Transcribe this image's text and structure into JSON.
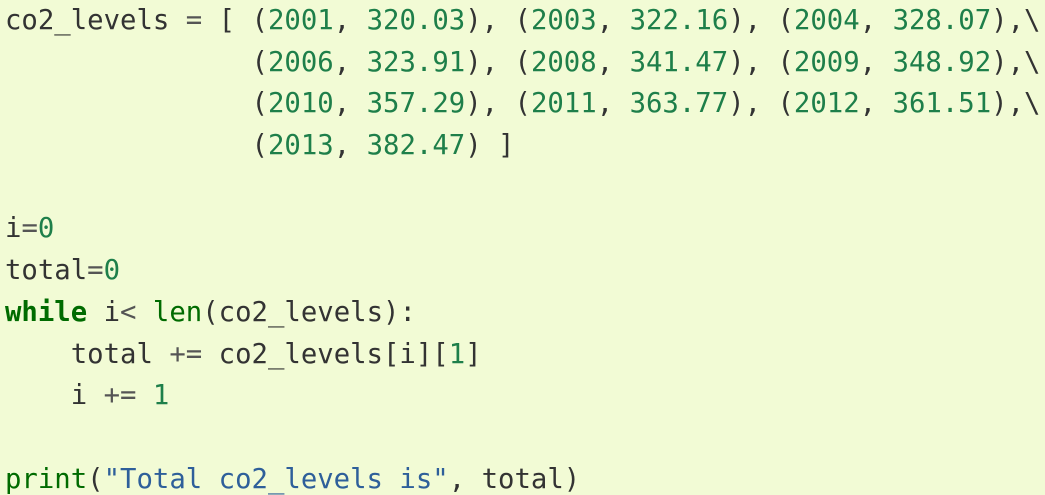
{
  "colors": {
    "background": "#f2fbd5",
    "text": "#333333",
    "number": "#1e7f4a",
    "keyword": "#006b00",
    "string": "#2e5f9a"
  },
  "code": {
    "lines": [
      [
        {
          "t": "co2_levels",
          "c": "txt"
        },
        {
          "t": " ",
          "c": "txt"
        },
        {
          "t": "=",
          "c": "op"
        },
        {
          "t": " [ (",
          "c": "txt"
        },
        {
          "t": "2001",
          "c": "num"
        },
        {
          "t": ", ",
          "c": "txt"
        },
        {
          "t": "320.03",
          "c": "num"
        },
        {
          "t": "), (",
          "c": "txt"
        },
        {
          "t": "2003",
          "c": "num"
        },
        {
          "t": ", ",
          "c": "txt"
        },
        {
          "t": "322.16",
          "c": "num"
        },
        {
          "t": "), (",
          "c": "txt"
        },
        {
          "t": "2004",
          "c": "num"
        },
        {
          "t": ", ",
          "c": "txt"
        },
        {
          "t": "328.07",
          "c": "num"
        },
        {
          "t": "),\\",
          "c": "txt"
        }
      ],
      [
        {
          "t": "               (",
          "c": "txt"
        },
        {
          "t": "2006",
          "c": "num"
        },
        {
          "t": ", ",
          "c": "txt"
        },
        {
          "t": "323.91",
          "c": "num"
        },
        {
          "t": "), (",
          "c": "txt"
        },
        {
          "t": "2008",
          "c": "num"
        },
        {
          "t": ", ",
          "c": "txt"
        },
        {
          "t": "341.47",
          "c": "num"
        },
        {
          "t": "), (",
          "c": "txt"
        },
        {
          "t": "2009",
          "c": "num"
        },
        {
          "t": ", ",
          "c": "txt"
        },
        {
          "t": "348.92",
          "c": "num"
        },
        {
          "t": "),\\",
          "c": "txt"
        }
      ],
      [
        {
          "t": "               (",
          "c": "txt"
        },
        {
          "t": "2010",
          "c": "num"
        },
        {
          "t": ", ",
          "c": "txt"
        },
        {
          "t": "357.29",
          "c": "num"
        },
        {
          "t": "), (",
          "c": "txt"
        },
        {
          "t": "2011",
          "c": "num"
        },
        {
          "t": ", ",
          "c": "txt"
        },
        {
          "t": "363.77",
          "c": "num"
        },
        {
          "t": "), (",
          "c": "txt"
        },
        {
          "t": "2012",
          "c": "num"
        },
        {
          "t": ", ",
          "c": "txt"
        },
        {
          "t": "361.51",
          "c": "num"
        },
        {
          "t": "),\\",
          "c": "txt"
        }
      ],
      [
        {
          "t": "               (",
          "c": "txt"
        },
        {
          "t": "2013",
          "c": "num"
        },
        {
          "t": ", ",
          "c": "txt"
        },
        {
          "t": "382.47",
          "c": "num"
        },
        {
          "t": ") ]",
          "c": "txt"
        }
      ],
      [],
      [
        {
          "t": "i",
          "c": "txt"
        },
        {
          "t": "=",
          "c": "op"
        },
        {
          "t": "0",
          "c": "num"
        }
      ],
      [
        {
          "t": "total",
          "c": "txt"
        },
        {
          "t": "=",
          "c": "op"
        },
        {
          "t": "0",
          "c": "num"
        }
      ],
      [
        {
          "t": "while",
          "c": "kw"
        },
        {
          "t": " i",
          "c": "txt"
        },
        {
          "t": "<",
          "c": "op"
        },
        {
          "t": " ",
          "c": "txt"
        },
        {
          "t": "len",
          "c": "bi"
        },
        {
          "t": "(co2_levels):",
          "c": "txt"
        }
      ],
      [
        {
          "t": "    total ",
          "c": "txt"
        },
        {
          "t": "+=",
          "c": "op"
        },
        {
          "t": " co2_levels[i][",
          "c": "txt"
        },
        {
          "t": "1",
          "c": "num"
        },
        {
          "t": "]",
          "c": "txt"
        }
      ],
      [
        {
          "t": "    i ",
          "c": "txt"
        },
        {
          "t": "+=",
          "c": "op"
        },
        {
          "t": " ",
          "c": "txt"
        },
        {
          "t": "1",
          "c": "num"
        }
      ],
      [],
      [
        {
          "t": "print",
          "c": "bi"
        },
        {
          "t": "(",
          "c": "txt"
        },
        {
          "t": "\"Total co2_levels is\"",
          "c": "str"
        },
        {
          "t": ", total)",
          "c": "txt"
        }
      ]
    ]
  }
}
